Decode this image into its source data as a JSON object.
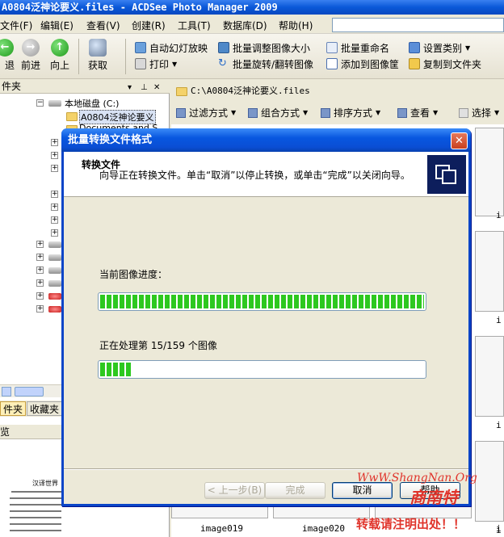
{
  "window": {
    "title": "A0804泛神论要义.files - ACDSee Photo Manager 2009"
  },
  "menu": [
    "文件(F)",
    "编辑(E)",
    "查看(V)",
    "创建(R)",
    "工具(T)",
    "数据库(D)",
    "帮助(H)"
  ],
  "toolbar": {
    "back": "退",
    "forward": "前进",
    "up": "向上",
    "acquire": "获取",
    "slideshow": "自动幻灯放映",
    "print": "打印",
    "batch_resize": "批量调整图像大小",
    "batch_rotate": "批量旋转/翻转图像",
    "batch_rename": "批量重命名",
    "add_to_basket": "添加到图像筐",
    "set_category": "设置类别",
    "copy_to_folder": "复制到文件夹"
  },
  "left_panel": {
    "title": "件夹",
    "controls": [
      "▾",
      "⊥",
      "✕"
    ],
    "tree": {
      "drive": "本地磁盘 (C:)",
      "selected_folder": "A0804泛神论要义",
      "folder2": "Documents and S"
    },
    "tabs": [
      "件夹",
      "收藏夹"
    ],
    "preview_title": "览",
    "preview_doc_title": "汉译世界"
  },
  "right_panel": {
    "path": "C:\\A0804泛神论要义.files",
    "toolbar": [
      "过滤方式",
      "组合方式",
      "排序方式",
      "查看",
      "选择"
    ],
    "thumbnail_labels": [
      "image019",
      "image020"
    ],
    "side_labels": [
      "i",
      "i",
      "i",
      "i",
      "i"
    ]
  },
  "dialog": {
    "title": "批量转换文件格式",
    "header_title": "转换文件",
    "header_desc": "向导正在转换文件。单击“取消”以停止转换，或单击“完成”以关闭向导。",
    "current_progress_label": "当前图像进度：",
    "current_progress": 1.0,
    "overall_label": "正在处理第 15/159 个图像",
    "overall_progress": 0.1,
    "buttons": {
      "back": "< 上一步(B)",
      "finish": "完成",
      "cancel": "取消",
      "help": "帮助"
    }
  },
  "watermark": {
    "line1": "WwW.ShangNan.Org",
    "line2": "商南特",
    "line3": "转载请注明出处！！"
  }
}
